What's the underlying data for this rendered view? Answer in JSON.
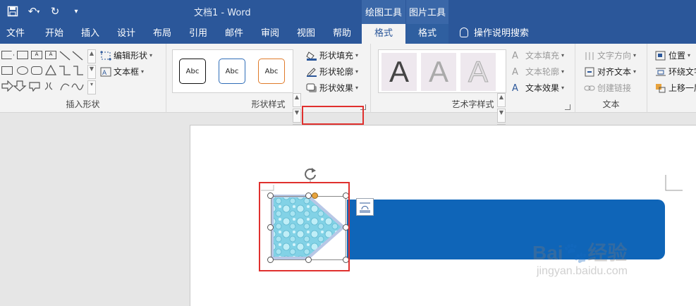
{
  "window": {
    "doc_title": "文档1  -  Word",
    "context_tabs": [
      "绘图工具",
      "图片工具"
    ]
  },
  "tabs": [
    "文件",
    "开始",
    "插入",
    "设计",
    "布局",
    "引用",
    "邮件",
    "审阅",
    "视图",
    "帮助",
    "格式",
    "格式"
  ],
  "search": {
    "label": "操作说明搜索"
  },
  "ribbon": {
    "insert_shapes": {
      "edit_shape": "编辑形状",
      "text_box": "文本框",
      "label": "插入形状"
    },
    "shape_styles": {
      "preset_text": "Abc",
      "fill": "形状填充",
      "outline": "形状轮廓",
      "effects": "形状效果",
      "label": "形状样式"
    },
    "wordart": {
      "letter": "A",
      "text_fill": "文本填充",
      "text_outline": "文本轮廓",
      "text_effects": "文本效果",
      "label": "艺术字样式"
    },
    "text": {
      "direction": "文字方向",
      "align": "对齐文本",
      "link": "创建链接",
      "label": "文本"
    },
    "arrange": {
      "position": "位置",
      "wrap": "环绕文字",
      "bring_forward": "上移一层"
    }
  },
  "watermark": {
    "brand": "Bai🐾经验",
    "url": "jingyan.baidu.com"
  },
  "colors": {
    "accent": "#2b579a",
    "shape_blue": "#0f65b8",
    "highlight": "#e0302e"
  }
}
